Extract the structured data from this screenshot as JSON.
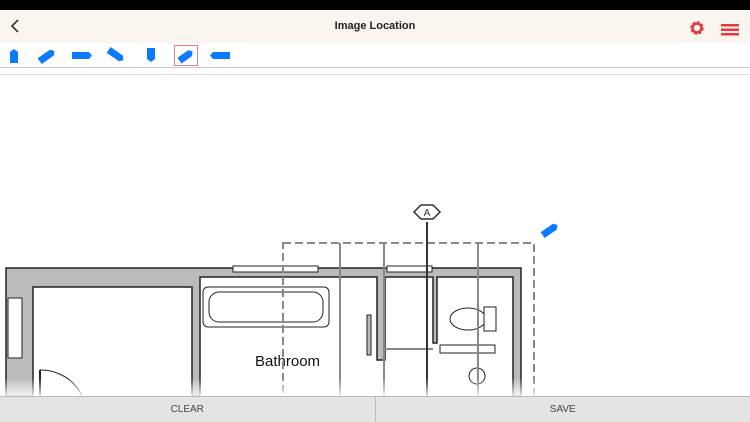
{
  "header": {
    "title": "Image Location",
    "back_icon": "chevron-left-icon",
    "settings_icon": "gear-icon",
    "menu_icon": "hamburger-menu-icon"
  },
  "toolbar": {
    "tools": [
      "arrow-up",
      "arrow-up-right",
      "arrow-right",
      "arrow-down-right",
      "arrow-down",
      "arrow-up-right-selected",
      "arrow-left"
    ],
    "selected_index": 5
  },
  "plan": {
    "room_label": "Bathroom",
    "marker_label": "A"
  },
  "colors": {
    "accent": "#0a7aff",
    "header_icon": "#e8383d",
    "header_bg": "#faf5ef"
  },
  "bottom": {
    "clear": "CLEAR",
    "save": "SAVE"
  }
}
